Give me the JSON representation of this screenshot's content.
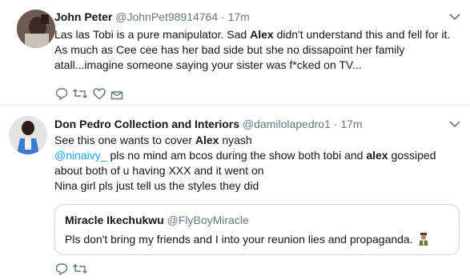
{
  "tweets": [
    {
      "name": "John Peter",
      "handle": "@JohnPet98914764",
      "sep": "·",
      "time": "17m",
      "lines": [
        [
          "Las las Tobi is a pure manipulator. Sad ",
          "Alex",
          " didn't understand this and fell for it."
        ],
        [
          "As much as Cee cee has her bad side but she no dissapoint her family"
        ],
        [
          "atall...imagine someone saying your sister was f*cked on TV..."
        ]
      ]
    },
    {
      "name": "Don Pedro Collection and Interiors",
      "handle": "@damilolapedro1",
      "sep": "·",
      "time": "17m",
      "line1": [
        "See this one wants to cover ",
        "Alex",
        " nyash"
      ],
      "line2_mention": "@ninaivy_",
      "line2_rest": " pls no mind am bcos during the show both tobi and ",
      "line2_bold": "alex",
      "line2_end": " gossiped",
      "line3": "about both of u having XXX and it went on",
      "line4": "Nina girl pls just tell us the styles they did",
      "quote": {
        "name": "Miracle Ikechukwu",
        "handle": "@FlyBoyMiracle",
        "text": "Pls don't bring my friends and I into your reunion lies and propaganda."
      }
    }
  ],
  "icons": [
    "reply-icon",
    "retweet-icon",
    "like-icon",
    "share-icon",
    "caret-down-icon"
  ],
  "colors": {
    "link": "#1da1f2",
    "muted": "#657786",
    "icon": "#657786",
    "text": "#14171a"
  }
}
